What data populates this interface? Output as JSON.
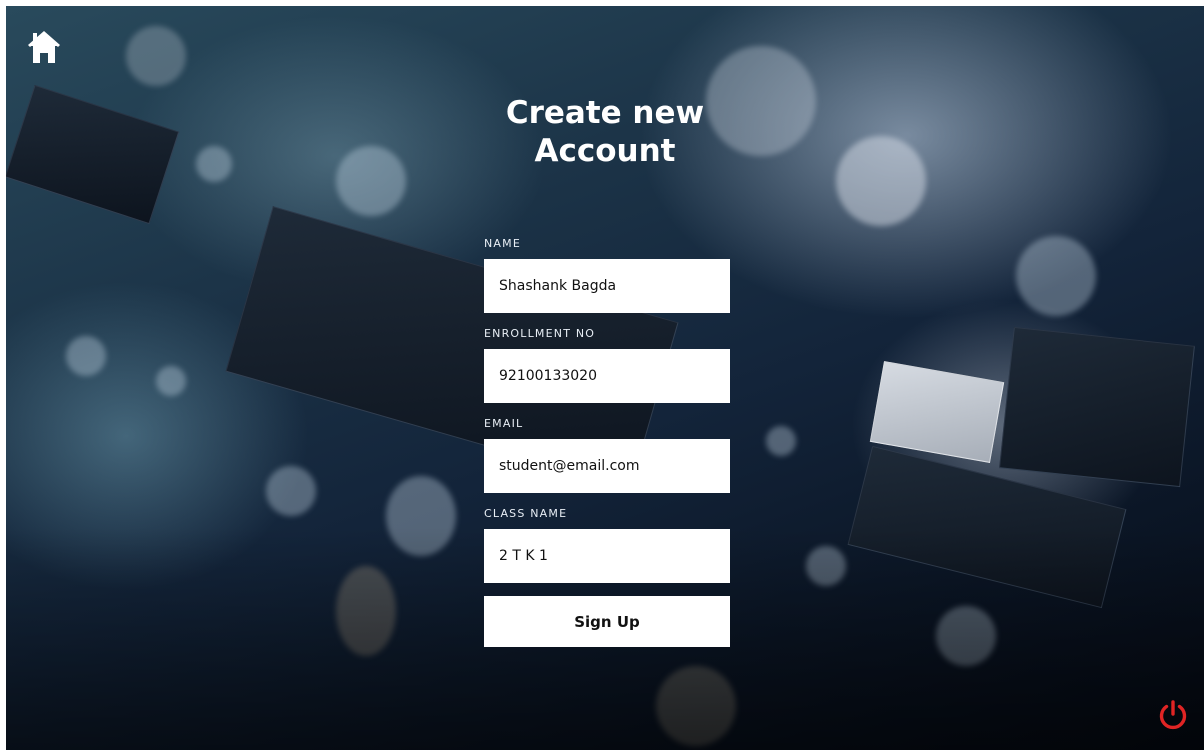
{
  "header": {
    "title_line1": "Create new",
    "title_line2": "Account"
  },
  "icons": {
    "home": "home-icon",
    "power": "power-icon",
    "power_color": "#e02424"
  },
  "form": {
    "name": {
      "label": "NAME",
      "value": "Shashank Bagda"
    },
    "enrollment": {
      "label": "ENROLLMENT NO",
      "value": "92100133020"
    },
    "email": {
      "label": "EMAIL",
      "value": "student@email.com"
    },
    "class_name": {
      "label": "CLASS NAME",
      "value": "2 T K 1"
    },
    "submit_label": "Sign Up"
  }
}
